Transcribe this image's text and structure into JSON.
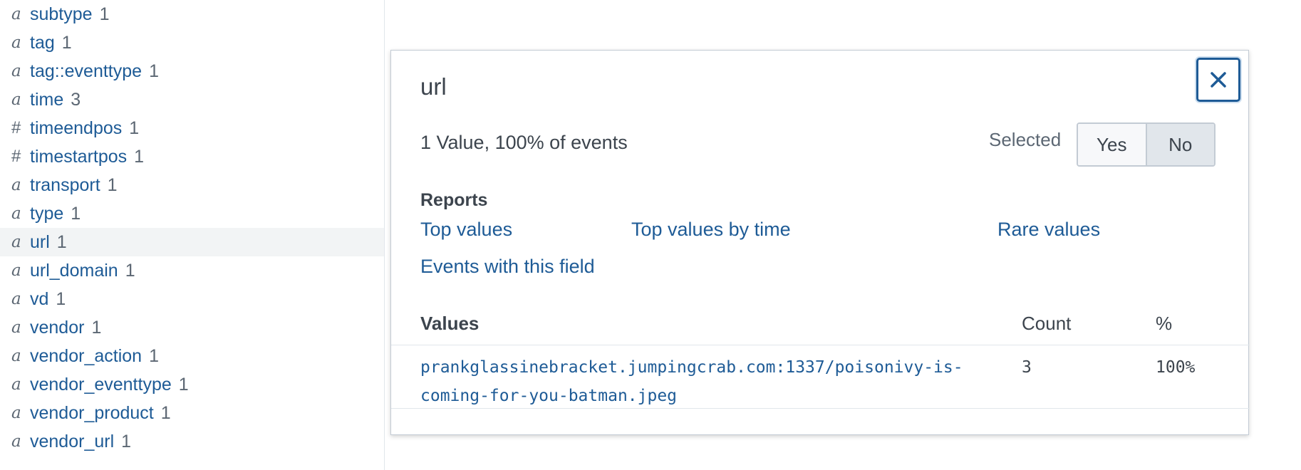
{
  "fields": [
    {
      "type": "a",
      "name": "subtype",
      "count": "1"
    },
    {
      "type": "a",
      "name": "tag",
      "count": "1"
    },
    {
      "type": "a",
      "name": "tag::eventtype",
      "count": "1"
    },
    {
      "type": "a",
      "name": "time",
      "count": "3"
    },
    {
      "type": "#",
      "name": "timeendpos",
      "count": "1"
    },
    {
      "type": "#",
      "name": "timestartpos",
      "count": "1"
    },
    {
      "type": "a",
      "name": "transport",
      "count": "1"
    },
    {
      "type": "a",
      "name": "type",
      "count": "1"
    },
    {
      "type": "a",
      "name": "url",
      "count": "1"
    },
    {
      "type": "a",
      "name": "url_domain",
      "count": "1"
    },
    {
      "type": "a",
      "name": "vd",
      "count": "1"
    },
    {
      "type": "a",
      "name": "vendor",
      "count": "1"
    },
    {
      "type": "a",
      "name": "vendor_action",
      "count": "1"
    },
    {
      "type": "a",
      "name": "vendor_eventtype",
      "count": "1"
    },
    {
      "type": "a",
      "name": "vendor_product",
      "count": "1"
    },
    {
      "type": "a",
      "name": "vendor_url",
      "count": "1"
    }
  ],
  "active_field": "url",
  "popover": {
    "title": "url",
    "close_icon": "close-icon",
    "summary": "1 Value, 100% of events",
    "selected_label": "Selected",
    "toggle": {
      "yes": "Yes",
      "no": "No",
      "selected": "No"
    },
    "reports_title": "Reports",
    "reports": {
      "top_values": "Top values",
      "top_values_by_time": "Top values by time",
      "rare_values": "Rare values",
      "events_with_field": "Events with this field"
    },
    "table": {
      "headers": {
        "values": "Values",
        "count": "Count",
        "percent": "%"
      },
      "rows": [
        {
          "value": "prankglassinebracket.jumpingcrab.com:1337/poisonivy-is-coming-for-you-batman.jpeg",
          "count": "3",
          "percent": "100%"
        }
      ]
    }
  },
  "colors": {
    "link": "#1e5b96",
    "text": "#3c444d",
    "muted": "#5c6773",
    "border": "#c3cbd4",
    "active_row": "#f2f4f5"
  }
}
